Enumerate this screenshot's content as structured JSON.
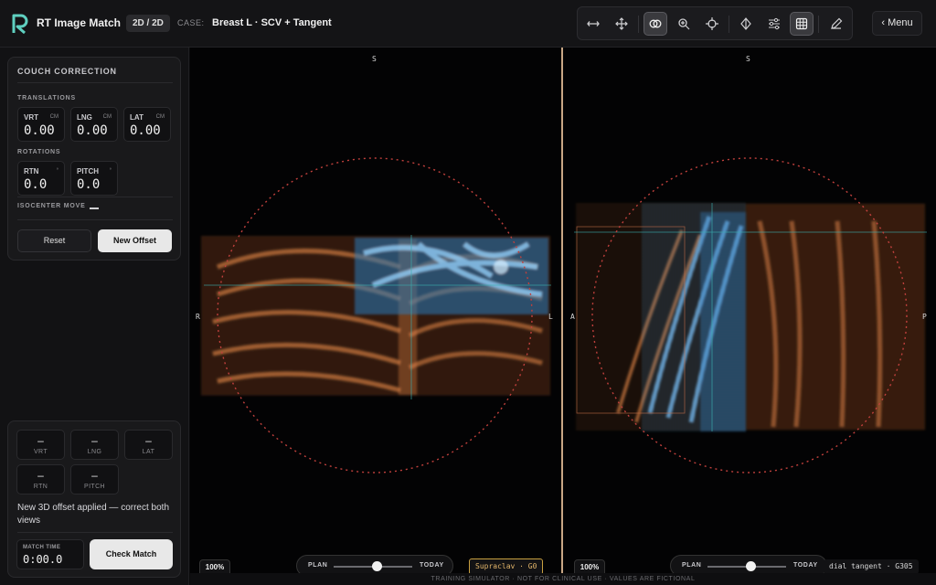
{
  "header": {
    "app_title": "RT Image Match",
    "mode_badge": "2D / 2D",
    "case_label": "CASE:",
    "case_value": "Breast L · SCV + Tangent",
    "menu_label": "‹ Menu",
    "tools": [
      {
        "name": "swap-horizontal-icon",
        "active": false
      },
      {
        "name": "move-icon",
        "active": false
      },
      {
        "name": "overlay-icon",
        "active": true
      },
      {
        "name": "zoom-icon",
        "active": false
      },
      {
        "name": "crosshair-icon",
        "active": false
      },
      {
        "name": "isocenter-icon",
        "active": false
      },
      {
        "name": "sliders-icon",
        "active": false
      },
      {
        "name": "grid-icon",
        "active": true
      },
      {
        "name": "pencil-icon",
        "active": false
      }
    ]
  },
  "couch": {
    "title": "COUCH CORRECTION",
    "translations_label": "TRANSLATIONS",
    "rotations_label": "ROTATIONS",
    "translations": [
      {
        "label": "VRT",
        "unit": "CM",
        "value": "0.00"
      },
      {
        "label": "LNG",
        "unit": "CM",
        "value": "0.00"
      },
      {
        "label": "LAT",
        "unit": "CM",
        "value": "0.00"
      }
    ],
    "rotations": [
      {
        "label": "RTN",
        "unit": "°",
        "value": "0.0"
      },
      {
        "label": "PITCH",
        "unit": "°",
        "value": "0.0"
      }
    ],
    "isocenter_label": "ISOCENTER MOVE",
    "reset_label": "Reset",
    "new_offset_label": "New Offset"
  },
  "result": {
    "values": [
      {
        "label": "VRT",
        "value": "–"
      },
      {
        "label": "LNG",
        "value": "–"
      },
      {
        "label": "LAT",
        "value": "–"
      },
      {
        "label": "RTN",
        "value": "–"
      },
      {
        "label": "PITCH",
        "value": "–"
      }
    ],
    "status_message": "New 3D offset applied — correct both views",
    "match_time_label": "MATCH TIME",
    "match_time_value": "0:00.0",
    "check_label": "Check Match"
  },
  "left_view": {
    "top": "S",
    "left": "R",
    "right": "L",
    "zoom": "100%",
    "plan_label": "PLAN",
    "today_label": "TODAY",
    "blend": 0.55,
    "field_tag": "Supraclav · G0"
  },
  "right_view": {
    "top": "S",
    "left": "A",
    "right": "P",
    "zoom": "100%",
    "plan_label": "PLAN",
    "today_label": "TODAY",
    "blend": 0.55,
    "field_tag": "dial tangent · G305"
  },
  "footer": "TRAINING SIMULATOR · NOT FOR CLINICAL USE · VALUES ARE FICTIONAL",
  "colors": {
    "plan": "#e07a3a",
    "today": "#4aa8e8",
    "dose_circle": "#c0403c"
  }
}
